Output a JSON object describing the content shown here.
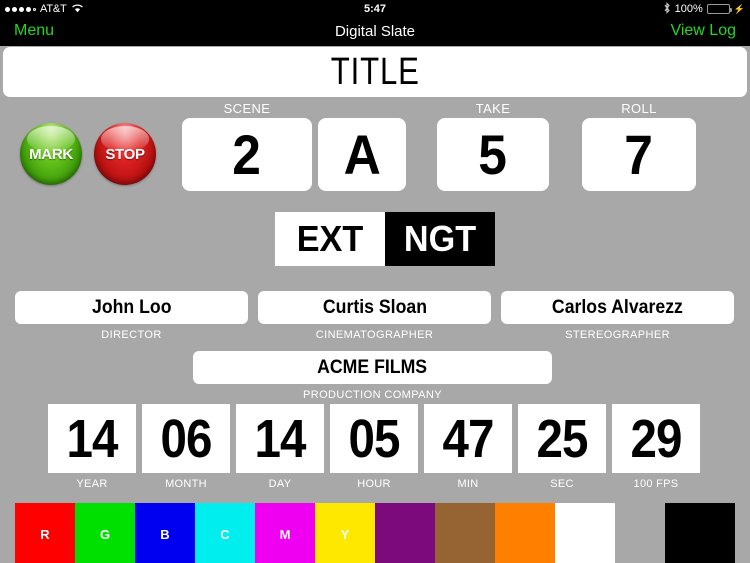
{
  "status_bar": {
    "carrier": "AT&T",
    "signal_dots_filled": 4,
    "signal_dots_total": 5,
    "wifi_icon": "wifi-icon",
    "time": "5:47",
    "bluetooth_icon": "bluetooth-icon",
    "battery_percent": "100%",
    "battery_charging": true,
    "battery_color": "#3ad33a"
  },
  "nav_bar": {
    "menu_label": "Menu",
    "title": "Digital Slate",
    "view_log_label": "View Log",
    "accent_color": "#23d723",
    "background_color": "#000000"
  },
  "title_field": {
    "value": "TITLE"
  },
  "buttons": {
    "mark": {
      "label": "MARK",
      "color": "#4fb50e"
    },
    "stop": {
      "label": "STOP",
      "color": "#cc1717"
    }
  },
  "slate": {
    "scene": {
      "label": "SCENE",
      "number": "2",
      "letter": "A"
    },
    "take": {
      "label": "TAKE",
      "value": "5"
    },
    "roll": {
      "label": "ROLL",
      "value": "7"
    }
  },
  "int_ext_toggle": {
    "location": "EXT",
    "time_of_day": "NGT"
  },
  "credits": [
    {
      "name": "John Loo",
      "role": "DIRECTOR"
    },
    {
      "name": "Curtis Sloan",
      "role": "CINEMATOGRAPHER"
    },
    {
      "name": "Carlos Alvarezz",
      "role": "STEREOGRAPHER"
    }
  ],
  "production": {
    "name": "ACME FILMS",
    "role": "PRODUCTION COMPANY"
  },
  "timecode": [
    {
      "value": "14",
      "label": "YEAR"
    },
    {
      "value": "06",
      "label": "MONTH"
    },
    {
      "value": "14",
      "label": "DAY"
    },
    {
      "value": "05",
      "label": "HOUR"
    },
    {
      "value": "47",
      "label": "MIN"
    },
    {
      "value": "25",
      "label": "SEC"
    },
    {
      "value": "29",
      "label": "100 FPS"
    }
  ],
  "color_bars": [
    {
      "letter": "R",
      "color": "#ff0000"
    },
    {
      "letter": "G",
      "color": "#00e000"
    },
    {
      "letter": "B",
      "color": "#0000f0"
    },
    {
      "letter": "C",
      "color": "#00eeee"
    },
    {
      "letter": "M",
      "color": "#f000f0"
    },
    {
      "letter": "Y",
      "color": "#ffe800"
    },
    {
      "letter": "",
      "color": "#7c0a7c"
    },
    {
      "letter": "",
      "color": "#966432"
    },
    {
      "letter": "",
      "color": "#ff8000"
    },
    {
      "letter": "",
      "color": "#ffffff"
    },
    {
      "letter": "",
      "color": "#000000"
    }
  ],
  "background_color": "#a8a8a8"
}
